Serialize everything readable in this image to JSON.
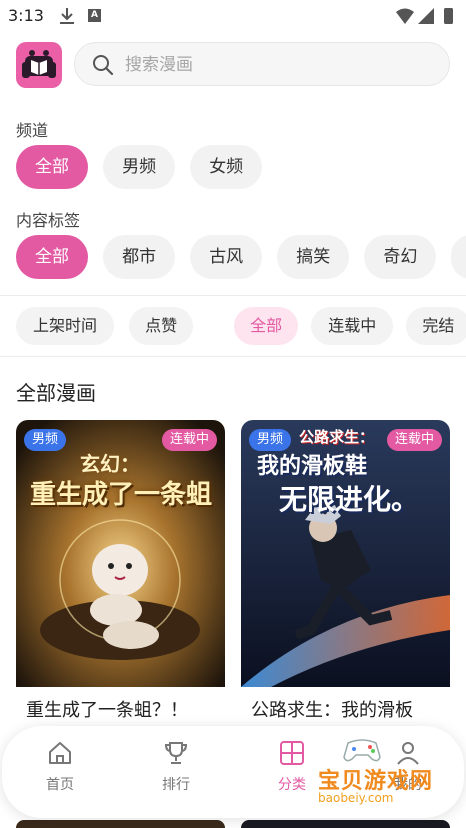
{
  "status": {
    "time": "3:13",
    "a_badge": "A"
  },
  "search": {
    "placeholder": "搜索漫画"
  },
  "channel": {
    "label": "频道",
    "items": [
      "全部",
      "男频",
      "女频"
    ]
  },
  "tags": {
    "label": "内容标签",
    "items": [
      "全部",
      "都市",
      "古风",
      "搞笑",
      "奇幻"
    ]
  },
  "filters": {
    "sort": [
      "上架时间",
      "点赞"
    ],
    "state": [
      "全部",
      "连载中",
      "完结"
    ]
  },
  "list": {
    "title": "全部漫画",
    "cards": [
      {
        "badge_left": "男频",
        "badge_right": "连载中",
        "name": "重生成了一条蛆？！",
        "cover_title_top": "玄幻：",
        "cover_title_main": "重生成了一条蛆"
      },
      {
        "badge_left": "男频",
        "badge_right": "连载中",
        "name": "公路求生：我的滑板",
        "cover_title_top": "公路求生：",
        "cover_title_main": "我的滑板鞋",
        "cover_title_sub": "无限进化。"
      }
    ]
  },
  "nav": {
    "items": [
      {
        "label": "首页",
        "icon": "home-icon"
      },
      {
        "label": "排行",
        "icon": "trophy-icon"
      },
      {
        "label": "分类",
        "icon": "grid-icon"
      },
      {
        "label": "我的",
        "icon": "user-icon"
      }
    ]
  },
  "watermark": {
    "text": "宝贝游戏网",
    "url": "baobeiy.com"
  },
  "colors": {
    "accent": "#e35aa3",
    "badge_blue": "#3b73e8"
  }
}
